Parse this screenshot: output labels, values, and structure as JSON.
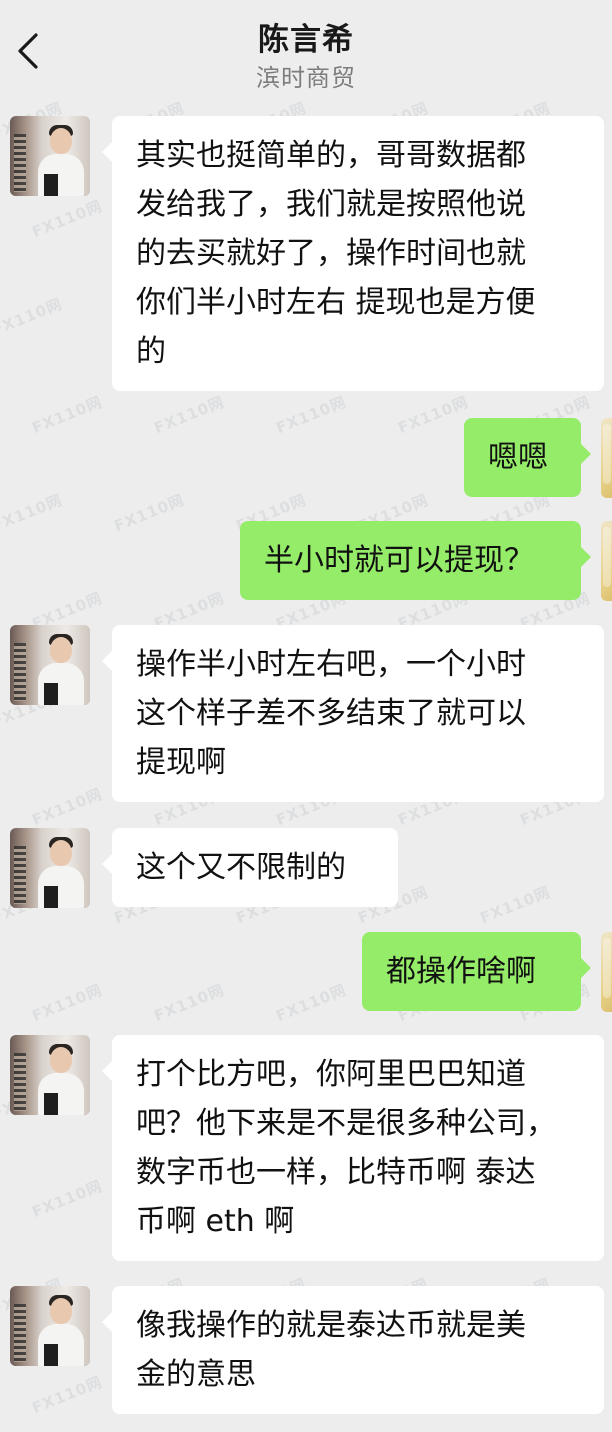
{
  "header": {
    "back_icon": "chevron-left-icon",
    "title": "陈言希",
    "subtitle": "滨时商贸"
  },
  "watermark": "FX110网",
  "messages": [
    {
      "side": "left",
      "text": "其实也挺简单的，哥哥数据都\n发给我了，我们就是按照他说\n的去买就好了，操作时间也就\n你们半小时左右 提现也是方便\n的"
    },
    {
      "side": "right",
      "text": "嗯嗯"
    },
    {
      "side": "right",
      "text": "半小时就可以提现？"
    },
    {
      "side": "left",
      "text": "操作半小时左右吧，一个小时\n这个样子差不多结束了就可以\n提现啊"
    },
    {
      "side": "left",
      "text": "这个又不限制的"
    },
    {
      "side": "right",
      "text": "都操作啥啊"
    },
    {
      "side": "left",
      "text": "打个比方吧，你阿里巴巴知道\n吧？他下来是不是很多种公司，\n数字币也一样，比特币啊 泰达\n币啊 eth 啊"
    },
    {
      "side": "left",
      "text": "像我操作的就是泰达币就是美\n金的意思"
    }
  ]
}
